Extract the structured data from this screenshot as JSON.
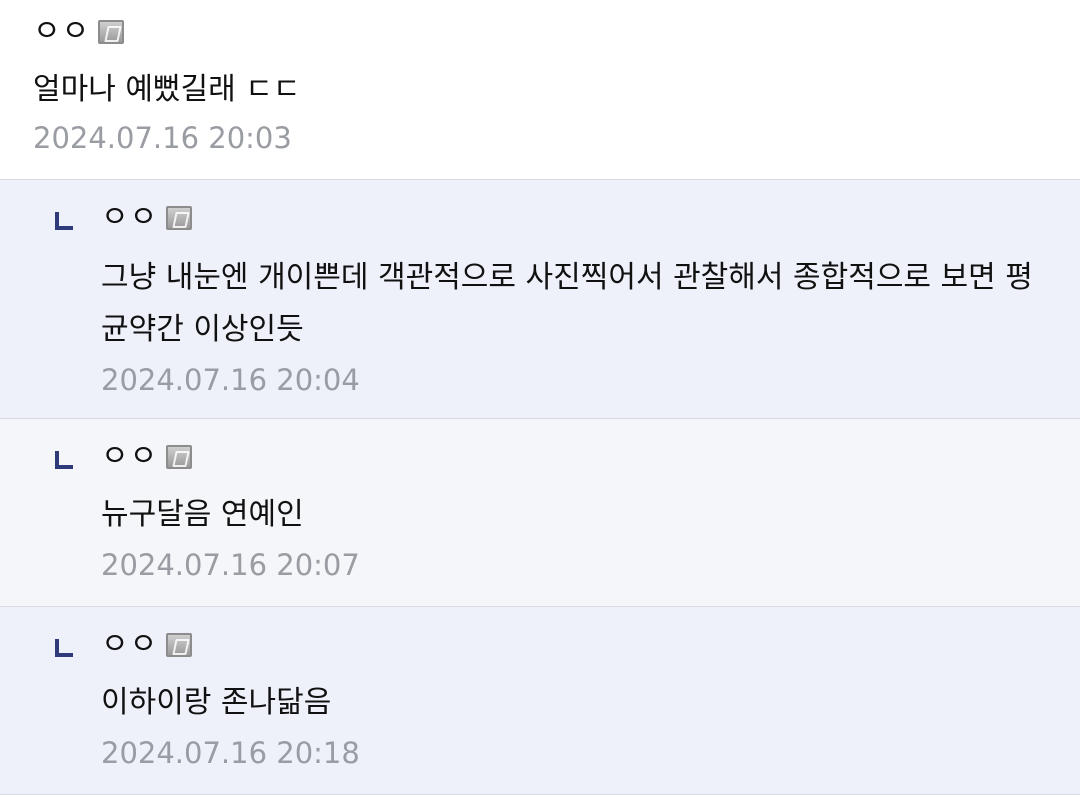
{
  "comments": [
    {
      "nickname": "ㅇㅇ",
      "icon": "fixed-nick-icon",
      "text": "얼마나 예뻤길래 ㄷㄷ",
      "time": "2024.07.16 20:03"
    },
    {
      "nickname": "ㅇㅇ",
      "icon": "fixed-nick-icon",
      "text": "그냥 내눈엔 개이쁜데 객관적으로 사진찍어서 관찰해서 종합적으로 보면 평균약간 이상인듯",
      "time": "2024.07.16 20:04"
    },
    {
      "nickname": "ㅇㅇ",
      "icon": "fixed-nick-icon",
      "text": "뉴구달음 연예인",
      "time": "2024.07.16 20:07"
    },
    {
      "nickname": "ㅇㅇ",
      "icon": "fixed-nick-icon",
      "text": "이하이랑 존나닮음",
      "time": "2024.07.16 20:18"
    }
  ],
  "colors": {
    "reply_bg_blue": "#eef1fa",
    "reply_bg_gray": "#f5f6fa",
    "reply_mark": "#2f3a7a",
    "timestamp": "#9a9ca3"
  }
}
